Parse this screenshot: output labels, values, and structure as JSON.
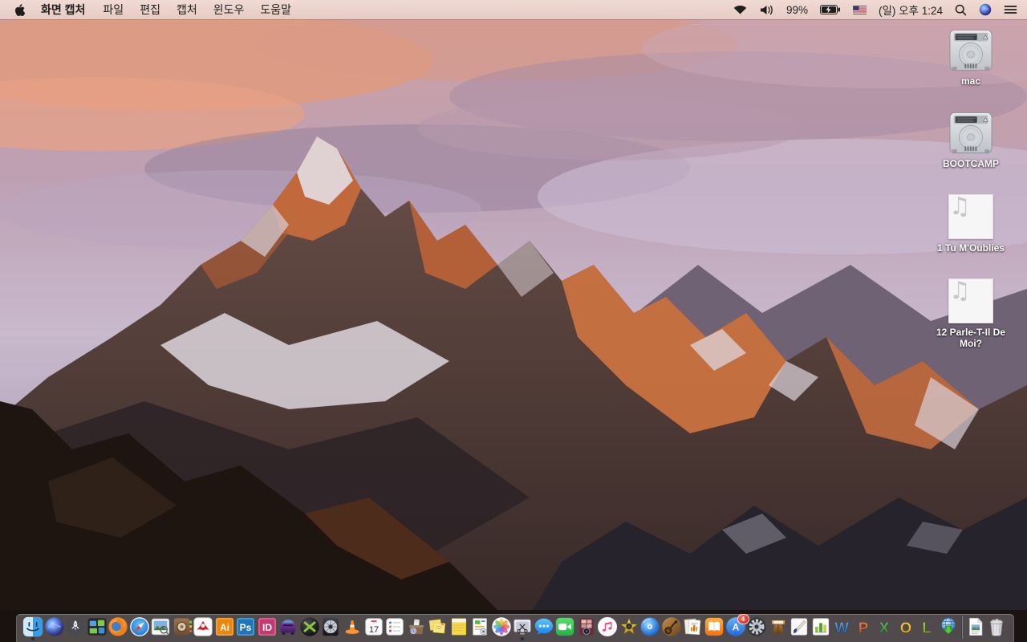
{
  "menubar": {
    "menus": [
      "화면 캡처",
      "파일",
      "편집",
      "캡처",
      "윈도우",
      "도움말"
    ],
    "status_items": [
      {
        "icon": "wifi"
      },
      {
        "icon": "volume"
      },
      {
        "name": "battery-percent",
        "text": "99%"
      },
      {
        "icon": "battery-charging"
      },
      {
        "icon": "us-flag"
      },
      {
        "name": "clock",
        "text": "(일) 오후 1:24"
      },
      {
        "icon": "spotlight-search"
      },
      {
        "icon": "siri"
      },
      {
        "icon": "notification-center"
      }
    ]
  },
  "desktop": {
    "icons": [
      {
        "kind": "drive",
        "label": "mac"
      },
      {
        "kind": "drive",
        "label": "BOOTCAMP"
      },
      {
        "kind": "audio",
        "label": "1 Tu M'Oublies"
      },
      {
        "kind": "audio",
        "label": "12 Parle-T-Il De Moi?"
      }
    ]
  },
  "dock": {
    "calendar_day": "17",
    "items": [
      {
        "icon": "finder",
        "running": true
      },
      {
        "icon": "siri"
      },
      {
        "icon": "launchpad"
      },
      {
        "icon": "mission-control"
      },
      {
        "icon": "firefox"
      },
      {
        "icon": "safari"
      },
      {
        "icon": "preview"
      },
      {
        "icon": "contacts-book"
      },
      {
        "icon": "acrobat-reader"
      },
      {
        "icon": "illustrator"
      },
      {
        "icon": "photoshop"
      },
      {
        "icon": "indesign"
      },
      {
        "icon": "toast"
      },
      {
        "icon": "video-converter"
      },
      {
        "icon": "disc-utility"
      },
      {
        "icon": "vlc"
      },
      {
        "icon": "calendar"
      },
      {
        "icon": "reminders"
      },
      {
        "icon": "mail-archive"
      },
      {
        "icon": "stickies"
      },
      {
        "icon": "notepad"
      },
      {
        "icon": "document-app"
      },
      {
        "icon": "photos"
      },
      {
        "icon": "screen-capture",
        "running": true
      },
      {
        "icon": "messages"
      },
      {
        "icon": "facetime"
      },
      {
        "icon": "photo-booth"
      },
      {
        "icon": "itunes"
      },
      {
        "icon": "imovie"
      },
      {
        "icon": "dvd-player"
      },
      {
        "icon": "garageband"
      },
      {
        "icon": "docs-chart"
      },
      {
        "icon": "ibooks"
      },
      {
        "icon": "app-store",
        "badge": "4"
      },
      {
        "icon": "system-preferences"
      },
      {
        "icon": "keynote"
      },
      {
        "icon": "pages"
      },
      {
        "icon": "numbers"
      },
      {
        "icon": "word"
      },
      {
        "icon": "powerpoint"
      },
      {
        "icon": "excel"
      },
      {
        "icon": "outlook"
      },
      {
        "icon": "lync"
      },
      {
        "icon": "downloader"
      },
      {
        "icon": "separator"
      },
      {
        "icon": "document-file"
      },
      {
        "icon": "trash",
        "full": true
      }
    ]
  }
}
